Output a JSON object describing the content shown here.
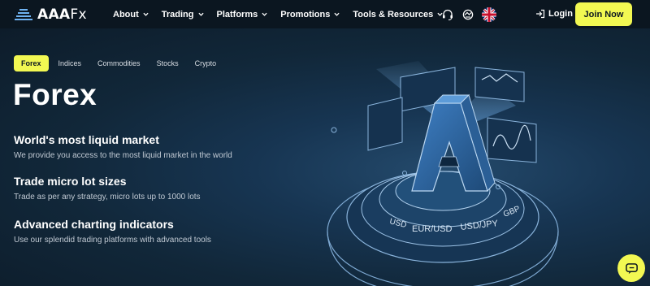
{
  "brand": {
    "name_bold": "AAA",
    "name_rest": "Fx"
  },
  "nav": {
    "items": [
      {
        "label": "About"
      },
      {
        "label": "Trading"
      },
      {
        "label": "Platforms"
      },
      {
        "label": "Promotions"
      },
      {
        "label": "Tools & Resources"
      }
    ],
    "login_label": "Login",
    "join_label": "Join Now"
  },
  "hero": {
    "tabs": [
      {
        "label": "Forex",
        "active": true
      },
      {
        "label": "Indices",
        "active": false
      },
      {
        "label": "Commodities",
        "active": false
      },
      {
        "label": "Stocks",
        "active": false
      },
      {
        "label": "Crypto",
        "active": false
      }
    ],
    "title": "Forex",
    "features": [
      {
        "heading": "World's most liquid market",
        "text": "We provide you access to the most liquid market in the world"
      },
      {
        "heading": "Trade micro lot sizes",
        "text": "Trade as per any strategy, micro lots up to 1000 lots"
      },
      {
        "heading": "Advanced charting indicators",
        "text": "Use our splendid trading platforms with advanced tools"
      }
    ],
    "illustration": {
      "ring_text": [
        "USD",
        "EUR/USD",
        "USD/JPY",
        "GBP"
      ]
    }
  },
  "colors": {
    "accent": "#f2f852",
    "navbar_bg": "#0b1620",
    "hero_bg": "#112739",
    "illustration_blue": "#4a90d9"
  },
  "icons": {
    "logo": "stacked-lines-logo",
    "support": "headset-icon",
    "language_flag": "uk-flag-icon",
    "login": "login-arrow-icon",
    "chat": "chat-bubble-icon"
  }
}
